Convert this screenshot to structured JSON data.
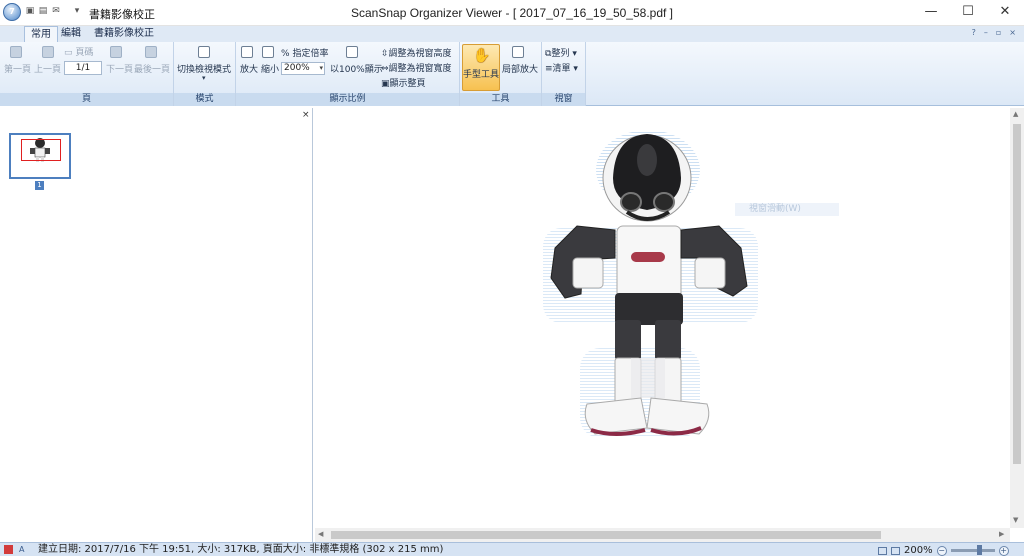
{
  "titlebar": {
    "orb_label": "7",
    "doc_tab_title": "書籍影像校正",
    "window_title": "ScanSnap Organizer Viewer - [ 2017_07_16_19_50_58.pdf ]",
    "min_glyph": "—",
    "max_glyph": "☐",
    "close_glyph": "✕"
  },
  "ribbon_tabs": [
    "常用",
    "編輯",
    "書籍影像校正"
  ],
  "ribbon_right": {
    "help": "?",
    "min": "–",
    "restore": "▫",
    "close": "×"
  },
  "groups": {
    "page": {
      "label": "頁",
      "first": "第一頁",
      "prev": "上一頁",
      "page_num_label": "頁碼",
      "page_value": "1/1",
      "next": "下一頁",
      "last": "最後一頁"
    },
    "mode": {
      "label": "模式",
      "switch": "切換檢視模式"
    },
    "scale": {
      "label": "顯示比例",
      "zoom_in": "放大",
      "zoom_out": "縮小",
      "specify": "指定倍率",
      "zoom_value": "200%",
      "actual": "以100%顯示",
      "fit_height": "調整為視窗高度",
      "fit_width": "調整為視窗寬度",
      "fit_page": "顯示整頁"
    },
    "tools": {
      "label": "工具",
      "hand": "手型工具",
      "partial": "局部放大"
    },
    "view": {
      "label": "視窗",
      "arrange": "整列",
      "list": "清單"
    }
  },
  "thumbnail": {
    "page_number": "1"
  },
  "panel_close": "×",
  "viewer": {
    "faint_label": "視窗滑動(W)"
  },
  "statusbar": {
    "text": "建立日期: 2017/7/16 下午 19:51, 大小: 317KB, 頁面大小: 非標準規格 (302 x 215 mm)",
    "zoom": "200%",
    "zoom_minus": "−",
    "zoom_plus": "+"
  }
}
